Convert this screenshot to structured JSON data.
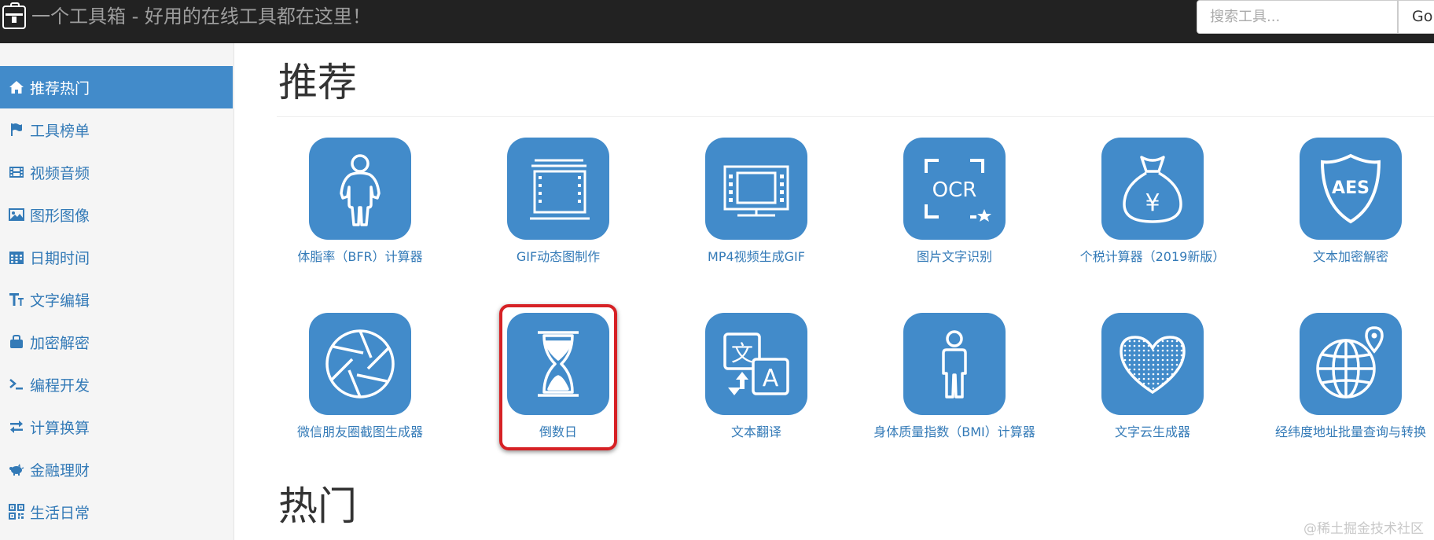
{
  "header": {
    "title": "一个工具箱 - 好用的在线工具都在这里！",
    "search_placeholder": "搜索工具...",
    "go_label": "Go"
  },
  "sidebar": {
    "items": [
      {
        "label": "推荐热门",
        "icon": "home-icon",
        "active": true
      },
      {
        "label": "工具榜单",
        "icon": "flag-icon"
      },
      {
        "label": "视频音频",
        "icon": "film-icon"
      },
      {
        "label": "图形图像",
        "icon": "image-icon"
      },
      {
        "label": "日期时间",
        "icon": "calendar-icon"
      },
      {
        "label": "文字编辑",
        "icon": "text-height-icon"
      },
      {
        "label": "加密解密",
        "icon": "briefcase-icon"
      },
      {
        "label": "编程开发",
        "icon": "terminal-icon"
      },
      {
        "label": "计算换算",
        "icon": "exchange-icon"
      },
      {
        "label": "金融理财",
        "icon": "piggy-bank-icon"
      },
      {
        "label": "生活日常",
        "icon": "qrcode-icon"
      }
    ]
  },
  "main": {
    "recommended_title": "推荐",
    "hot_title": "热门",
    "tools": [
      {
        "label": "体脂率（BFR）计算器",
        "icon": "body-figure-icon"
      },
      {
        "label": "GIF动态图制作",
        "icon": "film-strip-icon"
      },
      {
        "label": "MP4视频生成GIF",
        "icon": "monitor-film-icon"
      },
      {
        "label": "图片文字识别",
        "icon": "ocr-icon",
        "icon_text": "OCR"
      },
      {
        "label": "个税计算器（2019新版）",
        "icon": "money-bag-icon",
        "icon_text": "¥"
      },
      {
        "label": "文本加密解密",
        "icon": "aes-shield-icon",
        "icon_text": "AES"
      },
      {
        "label": "微信朋友圈截图生成器",
        "icon": "aperture-icon"
      },
      {
        "label": "倒数日",
        "icon": "hourglass-icon",
        "highlighted": true
      },
      {
        "label": "文本翻译",
        "icon": "translate-icon",
        "icon_text_a": "文",
        "icon_text_b": "A"
      },
      {
        "label": "身体质量指数（BMI）计算器",
        "icon": "person-icon"
      },
      {
        "label": "文字云生成器",
        "icon": "heart-dots-icon"
      },
      {
        "label": "经纬度地址批量查询与转换",
        "icon": "globe-pin-icon"
      }
    ]
  },
  "watermark": "@稀土掘金技术社区",
  "colors": {
    "topbar": "#222222",
    "accent": "#428bca",
    "link": "#337ab7",
    "highlight": "#d62125"
  }
}
